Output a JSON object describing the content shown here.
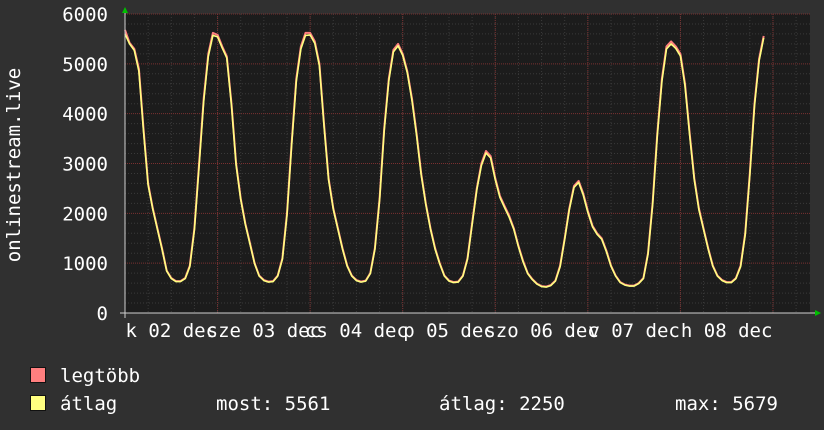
{
  "chart_data": {
    "type": "line",
    "ylabel": "onlinestream.live",
    "ylim": [
      0,
      6000
    ],
    "yticks": [
      0,
      1000,
      2000,
      3000,
      4000,
      5000,
      6000
    ],
    "xlim": [
      0,
      7.4
    ],
    "xtick_labels": [
      {
        "x": 0.5,
        "label": "k 02 dec"
      },
      {
        "x": 1.5,
        "label": "sze 03 dec"
      },
      {
        "x": 2.5,
        "label": "cs 04 dec"
      },
      {
        "x": 3.5,
        "label": "p 05 dec"
      },
      {
        "x": 4.5,
        "label": "szo 06 dec"
      },
      {
        "x": 5.5,
        "label": "v 07 dec"
      },
      {
        "x": 6.5,
        "label": "h 08 dec"
      }
    ],
    "grid": true,
    "series": [
      {
        "name": "legtöbb",
        "color": "#ff7f7f",
        "points": [
          [
            0,
            5679
          ],
          [
            0.05,
            5420
          ],
          [
            0.1,
            5300
          ],
          [
            0.15,
            4900
          ],
          [
            0.2,
            3700
          ],
          [
            0.25,
            2600
          ],
          [
            0.3,
            2100
          ],
          [
            0.35,
            1700
          ],
          [
            0.4,
            1300
          ],
          [
            0.45,
            850
          ],
          [
            0.5,
            700
          ],
          [
            0.55,
            640
          ],
          [
            0.6,
            640
          ],
          [
            0.65,
            700
          ],
          [
            0.7,
            950
          ],
          [
            0.75,
            1700
          ],
          [
            0.8,
            3000
          ],
          [
            0.85,
            4300
          ],
          [
            0.9,
            5200
          ],
          [
            0.95,
            5620
          ],
          [
            1.0,
            5580
          ],
          [
            1.05,
            5350
          ],
          [
            1.1,
            5150
          ],
          [
            1.15,
            4200
          ],
          [
            1.2,
            3000
          ],
          [
            1.25,
            2300
          ],
          [
            1.3,
            1800
          ],
          [
            1.35,
            1400
          ],
          [
            1.4,
            1000
          ],
          [
            1.45,
            750
          ],
          [
            1.5,
            660
          ],
          [
            1.55,
            630
          ],
          [
            1.6,
            640
          ],
          [
            1.65,
            750
          ],
          [
            1.7,
            1100
          ],
          [
            1.75,
            2000
          ],
          [
            1.8,
            3400
          ],
          [
            1.85,
            4700
          ],
          [
            1.9,
            5350
          ],
          [
            1.95,
            5620
          ],
          [
            2.0,
            5620
          ],
          [
            2.05,
            5450
          ],
          [
            2.1,
            5000
          ],
          [
            2.15,
            3800
          ],
          [
            2.2,
            2700
          ],
          [
            2.25,
            2100
          ],
          [
            2.3,
            1700
          ],
          [
            2.35,
            1300
          ],
          [
            2.4,
            950
          ],
          [
            2.45,
            750
          ],
          [
            2.5,
            660
          ],
          [
            2.55,
            630
          ],
          [
            2.6,
            650
          ],
          [
            2.65,
            800
          ],
          [
            2.7,
            1300
          ],
          [
            2.75,
            2300
          ],
          [
            2.8,
            3700
          ],
          [
            2.85,
            4700
          ],
          [
            2.9,
            5280
          ],
          [
            2.95,
            5400
          ],
          [
            3.0,
            5200
          ],
          [
            3.05,
            4850
          ],
          [
            3.1,
            4300
          ],
          [
            3.15,
            3600
          ],
          [
            3.2,
            2800
          ],
          [
            3.25,
            2200
          ],
          [
            3.3,
            1700
          ],
          [
            3.35,
            1300
          ],
          [
            3.4,
            1000
          ],
          [
            3.45,
            750
          ],
          [
            3.5,
            650
          ],
          [
            3.55,
            620
          ],
          [
            3.6,
            630
          ],
          [
            3.65,
            750
          ],
          [
            3.7,
            1100
          ],
          [
            3.75,
            1800
          ],
          [
            3.8,
            2500
          ],
          [
            3.85,
            3000
          ],
          [
            3.9,
            3250
          ],
          [
            3.95,
            3150
          ],
          [
            4.0,
            2700
          ],
          [
            4.05,
            2350
          ],
          [
            4.1,
            2150
          ],
          [
            4.15,
            1950
          ],
          [
            4.2,
            1700
          ],
          [
            4.25,
            1350
          ],
          [
            4.3,
            1050
          ],
          [
            4.35,
            800
          ],
          [
            4.4,
            680
          ],
          [
            4.45,
            590
          ],
          [
            4.5,
            540
          ],
          [
            4.55,
            530
          ],
          [
            4.6,
            560
          ],
          [
            4.65,
            650
          ],
          [
            4.7,
            950
          ],
          [
            4.75,
            1500
          ],
          [
            4.8,
            2100
          ],
          [
            4.85,
            2550
          ],
          [
            4.9,
            2650
          ],
          [
            4.95,
            2400
          ],
          [
            5.0,
            2050
          ],
          [
            5.05,
            1750
          ],
          [
            5.1,
            1600
          ],
          [
            5.15,
            1500
          ],
          [
            5.2,
            1250
          ],
          [
            5.25,
            950
          ],
          [
            5.3,
            750
          ],
          [
            5.35,
            620
          ],
          [
            5.4,
            570
          ],
          [
            5.45,
            550
          ],
          [
            5.5,
            550
          ],
          [
            5.55,
            600
          ],
          [
            5.6,
            700
          ],
          [
            5.65,
            1200
          ],
          [
            5.7,
            2200
          ],
          [
            5.75,
            3600
          ],
          [
            5.8,
            4700
          ],
          [
            5.85,
            5350
          ],
          [
            5.9,
            5450
          ],
          [
            5.95,
            5350
          ],
          [
            6.0,
            5200
          ],
          [
            6.05,
            4600
          ],
          [
            6.1,
            3600
          ],
          [
            6.15,
            2700
          ],
          [
            6.2,
            2100
          ],
          [
            6.25,
            1700
          ],
          [
            6.3,
            1300
          ],
          [
            6.35,
            950
          ],
          [
            6.4,
            750
          ],
          [
            6.45,
            660
          ],
          [
            6.5,
            620
          ],
          [
            6.55,
            620
          ],
          [
            6.6,
            700
          ],
          [
            6.65,
            950
          ],
          [
            6.7,
            1600
          ],
          [
            6.75,
            2800
          ],
          [
            6.8,
            4200
          ],
          [
            6.85,
            5100
          ],
          [
            6.9,
            5561
          ]
        ]
      },
      {
        "name": "átlag",
        "color": "#ffff80",
        "points": [
          [
            0,
            5600
          ],
          [
            0.05,
            5400
          ],
          [
            0.1,
            5270
          ],
          [
            0.15,
            4850
          ],
          [
            0.2,
            3650
          ],
          [
            0.25,
            2570
          ],
          [
            0.3,
            2080
          ],
          [
            0.35,
            1680
          ],
          [
            0.4,
            1280
          ],
          [
            0.45,
            840
          ],
          [
            0.5,
            690
          ],
          [
            0.55,
            630
          ],
          [
            0.6,
            630
          ],
          [
            0.65,
            690
          ],
          [
            0.7,
            930
          ],
          [
            0.75,
            1670
          ],
          [
            0.8,
            2950
          ],
          [
            0.85,
            4250
          ],
          [
            0.9,
            5150
          ],
          [
            0.95,
            5570
          ],
          [
            1.0,
            5540
          ],
          [
            1.05,
            5320
          ],
          [
            1.1,
            5120
          ],
          [
            1.15,
            4160
          ],
          [
            1.2,
            2970
          ],
          [
            1.25,
            2280
          ],
          [
            1.3,
            1780
          ],
          [
            1.35,
            1380
          ],
          [
            1.4,
            990
          ],
          [
            1.45,
            740
          ],
          [
            1.5,
            650
          ],
          [
            1.55,
            620
          ],
          [
            1.6,
            630
          ],
          [
            1.65,
            740
          ],
          [
            1.7,
            1080
          ],
          [
            1.75,
            1970
          ],
          [
            1.8,
            3360
          ],
          [
            1.85,
            4650
          ],
          [
            1.9,
            5300
          ],
          [
            1.95,
            5570
          ],
          [
            2.0,
            5580
          ],
          [
            2.05,
            5410
          ],
          [
            2.1,
            4960
          ],
          [
            2.15,
            3760
          ],
          [
            2.2,
            2670
          ],
          [
            2.25,
            2080
          ],
          [
            2.3,
            1680
          ],
          [
            2.35,
            1280
          ],
          [
            2.4,
            940
          ],
          [
            2.45,
            740
          ],
          [
            2.5,
            650
          ],
          [
            2.55,
            620
          ],
          [
            2.6,
            640
          ],
          [
            2.65,
            790
          ],
          [
            2.7,
            1280
          ],
          [
            2.75,
            2270
          ],
          [
            2.8,
            3660
          ],
          [
            2.85,
            4660
          ],
          [
            2.9,
            5240
          ],
          [
            2.95,
            5360
          ],
          [
            3.0,
            5170
          ],
          [
            3.05,
            4820
          ],
          [
            3.1,
            4260
          ],
          [
            3.15,
            3560
          ],
          [
            3.2,
            2770
          ],
          [
            3.25,
            2180
          ],
          [
            3.3,
            1680
          ],
          [
            3.35,
            1280
          ],
          [
            3.4,
            990
          ],
          [
            3.45,
            740
          ],
          [
            3.5,
            640
          ],
          [
            3.55,
            610
          ],
          [
            3.6,
            620
          ],
          [
            3.65,
            740
          ],
          [
            3.7,
            1080
          ],
          [
            3.75,
            1770
          ],
          [
            3.8,
            2470
          ],
          [
            3.85,
            2960
          ],
          [
            3.9,
            3210
          ],
          [
            3.95,
            3110
          ],
          [
            4.0,
            2670
          ],
          [
            4.05,
            2320
          ],
          [
            4.1,
            2120
          ],
          [
            4.15,
            1920
          ],
          [
            4.2,
            1680
          ],
          [
            4.25,
            1330
          ],
          [
            4.3,
            1030
          ],
          [
            4.35,
            790
          ],
          [
            4.4,
            670
          ],
          [
            4.45,
            580
          ],
          [
            4.5,
            530
          ],
          [
            4.55,
            520
          ],
          [
            4.6,
            550
          ],
          [
            4.65,
            640
          ],
          [
            4.7,
            930
          ],
          [
            4.75,
            1480
          ],
          [
            4.8,
            2070
          ],
          [
            4.85,
            2520
          ],
          [
            4.9,
            2620
          ],
          [
            4.95,
            2370
          ],
          [
            5.0,
            2020
          ],
          [
            5.05,
            1730
          ],
          [
            5.1,
            1580
          ],
          [
            5.15,
            1480
          ],
          [
            5.2,
            1230
          ],
          [
            5.25,
            940
          ],
          [
            5.3,
            740
          ],
          [
            5.35,
            610
          ],
          [
            5.4,
            560
          ],
          [
            5.45,
            540
          ],
          [
            5.5,
            540
          ],
          [
            5.55,
            590
          ],
          [
            5.6,
            690
          ],
          [
            5.65,
            1180
          ],
          [
            5.7,
            2170
          ],
          [
            5.75,
            3560
          ],
          [
            5.8,
            4650
          ],
          [
            5.85,
            5300
          ],
          [
            5.9,
            5400
          ],
          [
            5.95,
            5310
          ],
          [
            6.0,
            5160
          ],
          [
            6.05,
            4560
          ],
          [
            6.1,
            3560
          ],
          [
            6.15,
            2670
          ],
          [
            6.2,
            2070
          ],
          [
            6.25,
            1680
          ],
          [
            6.3,
            1280
          ],
          [
            6.35,
            940
          ],
          [
            6.4,
            740
          ],
          [
            6.45,
            650
          ],
          [
            6.5,
            610
          ],
          [
            6.55,
            610
          ],
          [
            6.6,
            690
          ],
          [
            6.65,
            930
          ],
          [
            6.7,
            1570
          ],
          [
            6.75,
            2760
          ],
          [
            6.8,
            4160
          ],
          [
            6.85,
            5060
          ],
          [
            6.9,
            5520
          ]
        ]
      }
    ]
  },
  "legend": {
    "items": [
      {
        "label": "legtöbb",
        "color": "#ff7f7f"
      },
      {
        "label": "átlag",
        "color": "#ffff80"
      }
    ],
    "stats": {
      "now": "most: 5561",
      "avg": "átlag: 2250",
      "max": "max: 5679"
    }
  }
}
